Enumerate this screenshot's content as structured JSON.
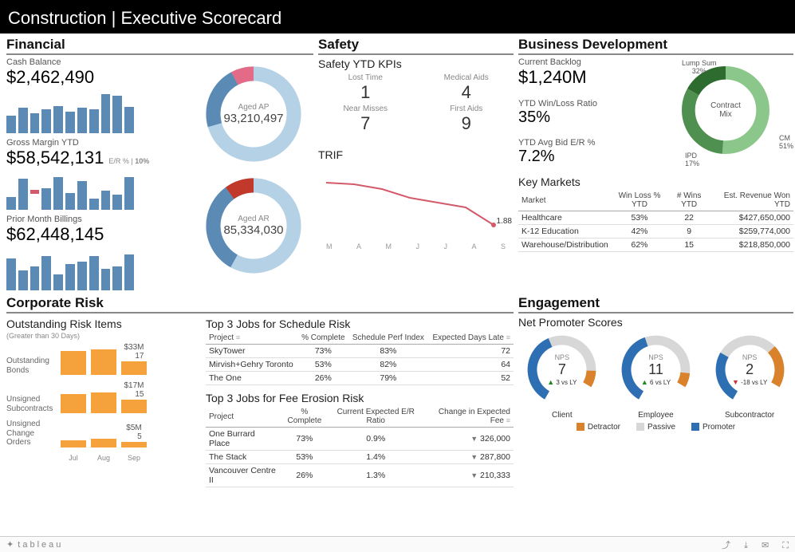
{
  "page": {
    "title": "Construction | Executive Scorecard"
  },
  "sections": {
    "financial": "Financial",
    "safety": "Safety",
    "bizdev": "Business Development",
    "risk": "Corporate Risk",
    "engagement": "Engagement"
  },
  "financial": {
    "cash_balance_lbl": "Cash Balance",
    "cash_balance": "$2,462,490",
    "gross_margin_lbl": "Gross Margin YTD",
    "gross_margin": "$58,542,131",
    "er_pct_lbl": "E/R %",
    "er_pct_val": "10%",
    "prior_billings_lbl": "Prior Month Billings",
    "prior_billings": "$62,448,145",
    "aged_ap_lbl": "Aged AP",
    "aged_ap": "93,210,497",
    "aged_ar_lbl": "Aged AR",
    "aged_ar": "85,334,030"
  },
  "safety": {
    "subtitle": "Safety YTD KPIs",
    "kpis": {
      "lost_time_lbl": "Lost Time",
      "lost_time": "1",
      "medical_lbl": "Medical Aids",
      "medical": "4",
      "near_miss_lbl": "Near Misses",
      "near_miss": "7",
      "first_aids_lbl": "First Aids",
      "first_aids": "9"
    },
    "trif_lbl": "TRIF",
    "trif_end": "1.88",
    "trif_months": {
      "m0": "M",
      "m1": "A",
      "m2": "M",
      "m3": "J",
      "m4": "J",
      "m5": "A",
      "m6": "S"
    }
  },
  "bizdev": {
    "backlog_lbl": "Current Backlog",
    "backlog": "$1,240M",
    "winloss_lbl": "YTD Win/Loss Ratio",
    "winloss": "35%",
    "avg_er_lbl": "YTD Avg Bid E/R %",
    "avg_er": "7.2%",
    "mix_title": "Contract\nMix",
    "mix": {
      "lump_lbl": "Lump Sum",
      "lump": "32%",
      "cm_lbl": "CM",
      "cm": "51%",
      "ipd_lbl": "IPD",
      "ipd": "17%"
    },
    "markets_title": "Key Markets",
    "markets_hdr": {
      "m": "Market",
      "wl": "Win Loss % YTD",
      "wins": "# Wins YTD",
      "rev": "Est. Revenue Won YTD"
    },
    "markets": [
      {
        "m": "Healthcare",
        "wl": "53%",
        "wins": "22",
        "rev": "$427,650,000"
      },
      {
        "m": "K-12 Education",
        "wl": "42%",
        "wins": "9",
        "rev": "$259,774,000"
      },
      {
        "m": "Warehouse/Distribution",
        "wl": "62%",
        "wins": "15",
        "rev": "$218,850,000"
      }
    ]
  },
  "risk": {
    "sub": "Outstanding Risk Items",
    "sub2": "(Greater than 30 Days)",
    "months": {
      "m0": "Jul",
      "m1": "Aug",
      "m2": "Sep"
    },
    "rows": [
      {
        "lbl": "Outstanding Bonds",
        "end_val": "$33M",
        "end_cnt": "17"
      },
      {
        "lbl": "Unsigned Subcontracts",
        "end_val": "$17M",
        "end_cnt": "15"
      },
      {
        "lbl": "Unsigned Change Orders",
        "end_val": "$5M",
        "end_cnt": "5"
      }
    ],
    "sched_title": "Top 3 Jobs for Schedule Risk",
    "sched_hdr": {
      "p": "Project",
      "pc": "% Complete",
      "spi": "Schedule Perf Index",
      "days": "Expected Days Late"
    },
    "sched": [
      {
        "p": "SkyTower",
        "pc": "73%",
        "spi": "83%",
        "days": "72"
      },
      {
        "p": "Mirvish+Gehry Toronto",
        "pc": "53%",
        "spi": "82%",
        "days": "64"
      },
      {
        "p": "The One",
        "pc": "26%",
        "spi": "79%",
        "days": "52"
      }
    ],
    "fee_title": "Top 3 Jobs for Fee Erosion Risk",
    "fee_hdr": {
      "p": "Project",
      "pc": "% Complete",
      "er": "Current Expected E/R Ratio",
      "chg": "Change in Expected Fee"
    },
    "fee": [
      {
        "p": "One Burrard Place",
        "pc": "73%",
        "er": "0.9%",
        "chg": "326,000"
      },
      {
        "p": "The Stack",
        "pc": "53%",
        "er": "1.4%",
        "chg": "287,800"
      },
      {
        "p": "Vancouver Centre II",
        "pc": "26%",
        "er": "1.3%",
        "chg": "210,333"
      }
    ]
  },
  "engagement": {
    "sub": "Net Promoter Scores",
    "nps": [
      {
        "lbl": "Client",
        "score": "7",
        "delta": "3 vs LY",
        "dir": "up"
      },
      {
        "lbl": "Employee",
        "score": "11",
        "delta": "6 vs LY",
        "dir": "up"
      },
      {
        "lbl": "Subcontractor",
        "score": "2",
        "delta": "-18 vs LY",
        "dir": "down"
      }
    ],
    "legend": {
      "det": "Detractor",
      "pas": "Passive",
      "pro": "Promoter"
    }
  },
  "footer": {
    "tableau": "tableau"
  },
  "chart_data": [
    {
      "type": "bar",
      "title": "Cash Balance trend (sparkline bars)",
      "categories": [
        "",
        "",
        "",
        "",
        "",
        "",
        "",
        "",
        "",
        "",
        ""
      ],
      "values": [
        22,
        30,
        24,
        28,
        32,
        26,
        30,
        28,
        42,
        40,
        30
      ],
      "ylim": [
        0,
        45
      ]
    },
    {
      "type": "bar",
      "title": "Gross Margin YTD trend (sparkline bars, with one loss)",
      "categories": [
        "",
        "",
        "",
        "",
        "",
        "",
        "",
        "",
        "",
        "",
        ""
      ],
      "values": [
        12,
        30,
        -4,
        22,
        32,
        16,
        28,
        10,
        18,
        14,
        32
      ],
      "ylim": [
        -10,
        35
      ]
    },
    {
      "type": "bar",
      "title": "Prior Month Billings trend (sparkline bars)",
      "categories": [
        "",
        "",
        "",
        "",
        "",
        "",
        "",
        "",
        "",
        "",
        ""
      ],
      "values": [
        28,
        18,
        22,
        30,
        14,
        24,
        26,
        30,
        20,
        22,
        32
      ],
      "ylim": [
        0,
        35
      ]
    },
    {
      "type": "pie",
      "title": "Aged AP",
      "series": [
        {
          "name": "Aged AP breakdown",
          "values": [
            70,
            22,
            8
          ]
        }
      ],
      "colors": [
        "#b5d1e6",
        "#5b8bb5",
        "#e36b88"
      ],
      "center_value": "93,210,497"
    },
    {
      "type": "pie",
      "title": "Aged AR",
      "series": [
        {
          "name": "Aged AR breakdown",
          "values": [
            58,
            32,
            10
          ]
        }
      ],
      "colors": [
        "#b5d1e6",
        "#5b8bb5",
        "#c0392b"
      ],
      "center_value": "85,334,030"
    },
    {
      "type": "line",
      "title": "TRIF",
      "x": [
        "M",
        "A",
        "M",
        "J",
        "J",
        "A",
        "S"
      ],
      "values": [
        2.6,
        2.55,
        2.45,
        2.3,
        2.2,
        2.1,
        1.88
      ],
      "ylim": [
        1.5,
        2.8
      ]
    },
    {
      "type": "pie",
      "title": "Contract Mix",
      "series": [
        {
          "name": "Mix",
          "values": [
            51,
            32,
            17
          ]
        }
      ],
      "labels": [
        "CM",
        "Lump Sum",
        "IPD"
      ],
      "colors": [
        "#8bc78b",
        "#4f8f4f",
        "#2e6b2e"
      ]
    },
    {
      "type": "table",
      "title": "Key Markets",
      "columns": [
        "Market",
        "Win Loss % YTD",
        "# Wins YTD",
        "Est. Revenue Won YTD"
      ],
      "rows": [
        [
          "Healthcare",
          "53%",
          "22",
          "$427,650,000"
        ],
        [
          "K-12 Education",
          "42%",
          "9",
          "$259,774,000"
        ],
        [
          "Warehouse/Distribution",
          "62%",
          "15",
          "$218,850,000"
        ]
      ]
    },
    {
      "type": "bar",
      "title": "Outstanding Bonds (count by month)",
      "categories": [
        "Jul",
        "Aug",
        "Sep"
      ],
      "values": [
        15,
        16,
        17
      ],
      "ylabel": "count",
      "annotation_end": "$33M"
    },
    {
      "type": "bar",
      "title": "Unsigned Subcontracts (count by month)",
      "categories": [
        "Jul",
        "Aug",
        "Sep"
      ],
      "values": [
        12,
        13,
        15
      ],
      "annotation_end": "$17M"
    },
    {
      "type": "bar",
      "title": "Unsigned Change Orders (count by month)",
      "categories": [
        "Jul",
        "Aug",
        "Sep"
      ],
      "values": [
        3,
        4,
        5
      ],
      "annotation_end": "$5M"
    },
    {
      "type": "table",
      "title": "Top 3 Jobs for Schedule Risk",
      "columns": [
        "Project",
        "% Complete",
        "Schedule Perf Index",
        "Expected Days Late"
      ],
      "rows": [
        [
          "SkyTower",
          "73%",
          "83%",
          "72"
        ],
        [
          "Mirvish+Gehry Toronto",
          "53%",
          "82%",
          "64"
        ],
        [
          "The One",
          "26%",
          "79%",
          "52"
        ]
      ]
    },
    {
      "type": "table",
      "title": "Top 3 Jobs for Fee Erosion Risk",
      "columns": [
        "Project",
        "% Complete",
        "Current Expected E/R Ratio",
        "Change in Expected Fee"
      ],
      "rows": [
        [
          "One Burrard Place",
          "73%",
          "0.9%",
          "-326,000"
        ],
        [
          "The Stack",
          "53%",
          "1.4%",
          "-287,800"
        ],
        [
          "Vancouver Centre II",
          "26%",
          "1.3%",
          "-210,333"
        ]
      ]
    },
    {
      "type": "pie",
      "title": "NPS Client",
      "labels": [
        "Promoter",
        "Passive",
        "Detractor"
      ],
      "values": [
        47,
        43,
        10
      ],
      "center_value": "7",
      "delta": "+3 vs LY"
    },
    {
      "type": "pie",
      "title": "NPS Employee",
      "labels": [
        "Promoter",
        "Passive",
        "Detractor"
      ],
      "values": [
        49,
        42,
        9
      ],
      "center_value": "11",
      "delta": "+6 vs LY"
    },
    {
      "type": "pie",
      "title": "NPS Subcontractor",
      "labels": [
        "Promoter",
        "Passive",
        "Detractor"
      ],
      "values": [
        34,
        38,
        28
      ],
      "center_value": "2",
      "delta": "-18 vs LY"
    }
  ]
}
